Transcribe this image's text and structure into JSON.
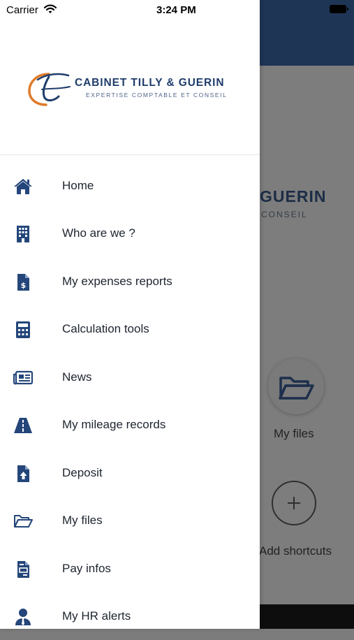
{
  "status_bar": {
    "carrier": "Carrier",
    "time": "3:24 PM"
  },
  "brand": {
    "name": "CABINET TILLY & GUERIN",
    "tagline": "EXPERTISE COMPTABLE ET CONSEIL",
    "color": "#1f3d6b",
    "accent": "#e07b2a"
  },
  "menu": [
    {
      "label": "Home",
      "icon": "home-icon"
    },
    {
      "label": "Who are we ?",
      "icon": "building-icon"
    },
    {
      "label": "My expenses reports",
      "icon": "expense-file-icon"
    },
    {
      "label": "Calculation tools",
      "icon": "calculator-icon"
    },
    {
      "label": "News",
      "icon": "newspaper-icon"
    },
    {
      "label": "My mileage records",
      "icon": "road-icon"
    },
    {
      "label": "Deposit",
      "icon": "upload-file-icon"
    },
    {
      "label": "My files",
      "icon": "folder-open-icon"
    },
    {
      "label": "Pay infos",
      "icon": "payslip-icon"
    },
    {
      "label": "My HR alerts",
      "icon": "user-tie-icon"
    }
  ],
  "background_screen": {
    "logo_fragment": "GUERIN",
    "tagline_fragment": "CONSEIL",
    "shortcuts": [
      {
        "label": "My files",
        "icon": "folder-open-icon"
      },
      {
        "label": "Add shortcuts",
        "icon": "plus-icon"
      }
    ]
  }
}
